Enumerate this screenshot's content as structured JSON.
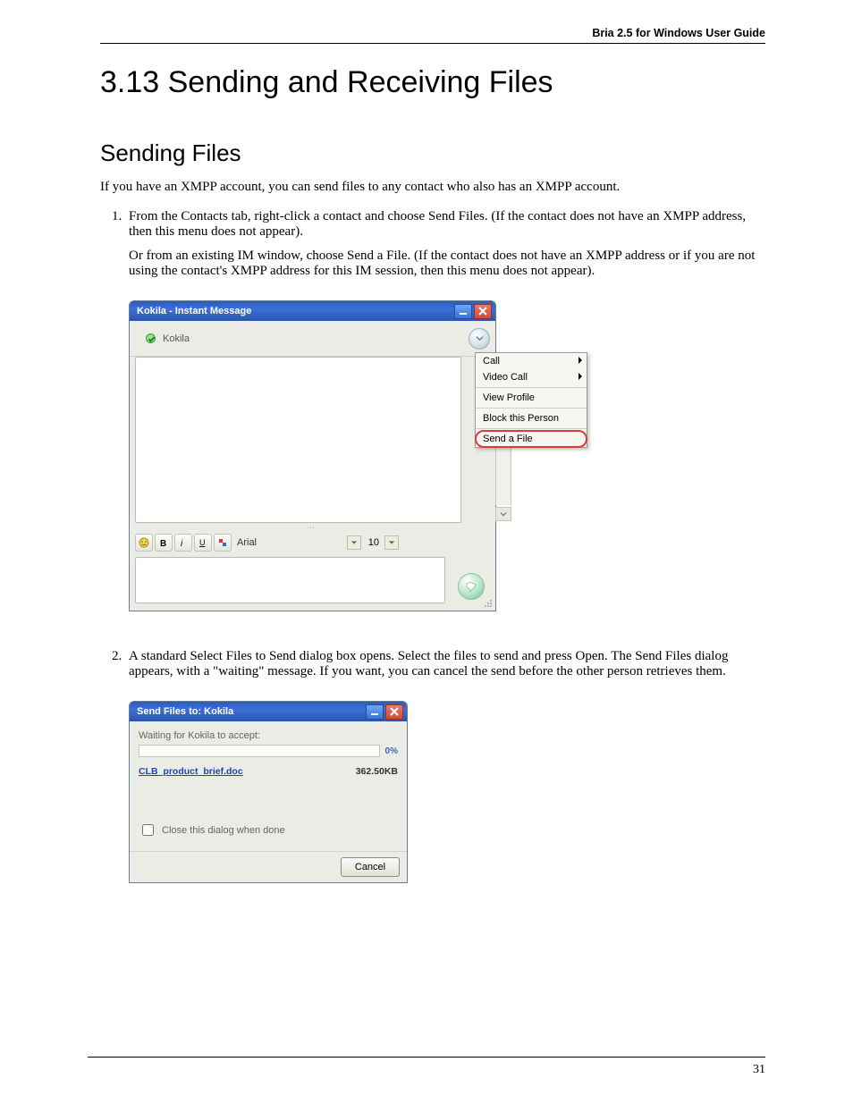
{
  "header": {
    "doc_title": "Bria 2.5 for Windows User Guide"
  },
  "headings": {
    "h1": "3.13 Sending and Receiving Files",
    "h2": "Sending Files"
  },
  "paragraphs": {
    "intro": "If you have an XMPP account, you can send files to any contact who also has an XMPP account.",
    "step1_a": "From the Contacts tab, right-click a contact and choose Send Files. (If the contact does not have an XMPP address, then this menu does not appear).",
    "step1_b": "Or from an existing IM window, choose Send a File. (If the contact does not have an XMPP address or if you are not using the contact's XMPP address for this IM session, then this menu does not appear).",
    "step2": "A standard Select Files to Send dialog box opens. Select the files to send and press Open. The Send Files dialog appears, with a \"waiting\" message. If you want, you can cancel the send before the other person retrieves them."
  },
  "im_window": {
    "title": "Kokila - Instant Message",
    "contact_name": "Kokila",
    "font_name": "Arial",
    "font_size": "10",
    "menu": {
      "call": "Call",
      "video_call": "Video Call",
      "view_profile": "View Profile",
      "block": "Block this Person",
      "send_file": "Send a File"
    }
  },
  "send_dialog": {
    "title": "Send Files to: Kokila",
    "waiting": "Waiting for Kokila to accept:",
    "progress_pct": "0%",
    "filename": "CLB_product_brief.doc",
    "filesize": "362.50KB",
    "close_when_done": "Close this dialog when done",
    "cancel": "Cancel"
  },
  "footer": {
    "page_number": "31"
  }
}
